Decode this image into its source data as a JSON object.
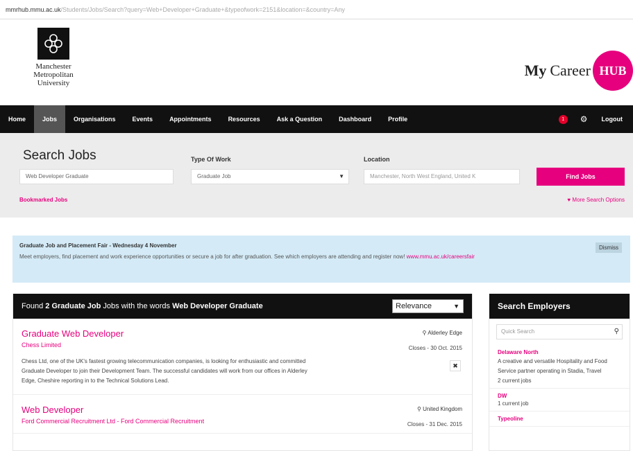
{
  "url": {
    "host": "mmrhub.mmu.ac.uk",
    "path": "/Students/Jobs/Search?query=Web+Developer+Graduate+&typeofwork=2151&location=&country=Any"
  },
  "logo": {
    "line1": "Manchester",
    "line2": "Metropolitan",
    "line3": "University"
  },
  "brand": {
    "my": "My",
    "career": "Career",
    "hub": "HUB",
    "accent": "#e6007e"
  },
  "nav": {
    "items": [
      "Home",
      "Jobs",
      "Organisations",
      "Events",
      "Appointments",
      "Resources",
      "Ask a Question",
      "Dashboard",
      "Profile"
    ],
    "active_index": 1,
    "notification_count": "1",
    "logout": "Logout"
  },
  "search": {
    "heading": "Search Jobs",
    "keyword_value": "Web Developer Graduate",
    "type_label": "Type Of Work",
    "type_value": "Graduate Job",
    "location_label": "Location",
    "location_placeholder": "Manchester, North West England, United K",
    "button": "Find Jobs",
    "bookmarked": "Bookmarked Jobs",
    "more_options": "More Search Options"
  },
  "notice": {
    "title": "Graduate Job and Placement Fair - Wednesday 4 November",
    "body": "Meet employers, find placement and work experience opportunities or secure a job for after graduation. See which employers are attending and register now!",
    "link": "www.mmu.ac.uk/careersfair",
    "dismiss": "Dismiss"
  },
  "results": {
    "prefix": "Found",
    "count": "2",
    "type": "Graduate Job",
    "middle": "Jobs with the words",
    "query": "Web Developer Graduate",
    "sort": "Relevance",
    "jobs": [
      {
        "title": "Graduate Web Developer",
        "company": "Chess Limited",
        "location": "Alderley Edge",
        "closes": "Closes - 30 Oct. 2015",
        "description": "Chess Ltd, one of the UK's fastest growing telecommunication companies, is looking for enthusiastic and committed Graduate Developer to join their Development Team. The successful candidates will work from our offices in Alderley Edge, Cheshire reporting in to the Technical Solutions Lead."
      },
      {
        "title": "Web Developer",
        "company": "Ford Commercial Recruitment Ltd - Ford Commercial Recruitment",
        "location": "United Kingdom",
        "closes": "Closes - 31 Dec. 2015",
        "description": ""
      }
    ]
  },
  "employers": {
    "heading": "Search Employers",
    "search_placeholder": "Quick Search",
    "list": [
      {
        "name": "Delaware North",
        "desc": "A creative and versatile Hospitality and Food Service partner operating in Stadia, Travel",
        "count": "2 current jobs"
      },
      {
        "name": "DW",
        "desc": "",
        "count": "1 current job"
      },
      {
        "name": "Typeoline",
        "desc": "",
        "count": ""
      }
    ]
  }
}
